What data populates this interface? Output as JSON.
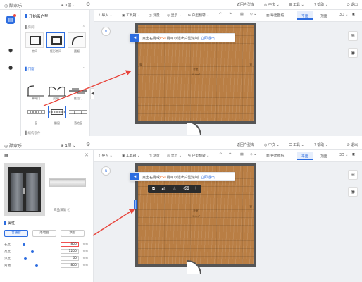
{
  "app": {
    "logo_text": "◎ 酷家乐",
    "floor_label": "1层",
    "top_right": {
      "create_house": "返回户型库",
      "lang": "中文",
      "tools": "工具",
      "help": "帮助",
      "exit": "退出"
    }
  },
  "toolbar": {
    "items": [
      {
        "label": "导入"
      },
      {
        "label": "工具箱"
      },
      {
        "label": "测量"
      },
      {
        "label": "显示"
      },
      {
        "label": "户型翻转"
      },
      {
        "label": "导出图纸"
      }
    ],
    "view_tabs": [
      {
        "label": "平面",
        "active": true
      },
      {
        "label": "顶面",
        "active": false
      },
      {
        "label": "3D",
        "active": false
      }
    ]
  },
  "panel1": {
    "library_title": "开始画户型",
    "sections": [
      {
        "label": "房间"
      },
      {
        "label": "门窗"
      },
      {
        "label": "结构部件"
      }
    ],
    "shapes": [
      {
        "label": "房间"
      },
      {
        "label": "矩形房间"
      },
      {
        "label": "圆弧"
      }
    ],
    "doors": [
      {
        "label": "单开门"
      },
      {
        "label": "双开门"
      },
      {
        "label": "推拉门"
      },
      {
        "label": "窗"
      },
      {
        "label": "飘窗"
      },
      {
        "label": "落地窗"
      }
    ]
  },
  "hint": {
    "prefix": "点击右键或",
    "esc": "ESC",
    "middle": "键可以退出户型绘制",
    "link": "立即退出"
  },
  "compass": {
    "label": "N"
  },
  "room_marks": {
    "center1": "卧室",
    "center2": "20.0m²",
    "side": "窗"
  },
  "panel2": {
    "detail_link": "商品详情 ⓘ",
    "prop_title": "属性",
    "modes": [
      {
        "label": "普通窗",
        "active": true
      },
      {
        "label": "落地窗",
        "active": false
      },
      {
        "label": "飘窗",
        "active": false
      }
    ],
    "props": [
      {
        "label": "长度",
        "value": "800",
        "unit": "mm",
        "fill": 0.25,
        "highlight": true
      },
      {
        "label": "高度",
        "value": "1200",
        "unit": "mm",
        "fill": 0.55,
        "highlight": false
      },
      {
        "label": "深度",
        "value": "60",
        "unit": "mm",
        "fill": 0.3,
        "highlight": false
      },
      {
        "label": "离地",
        "value": "800",
        "unit": "mm",
        "fill": 0.7,
        "highlight": false
      }
    ]
  },
  "colors": {
    "accent": "#2d6de0",
    "hint_esc": "#f0671e",
    "arrow": "#e8453c",
    "floor_wood": "#b97e44"
  }
}
